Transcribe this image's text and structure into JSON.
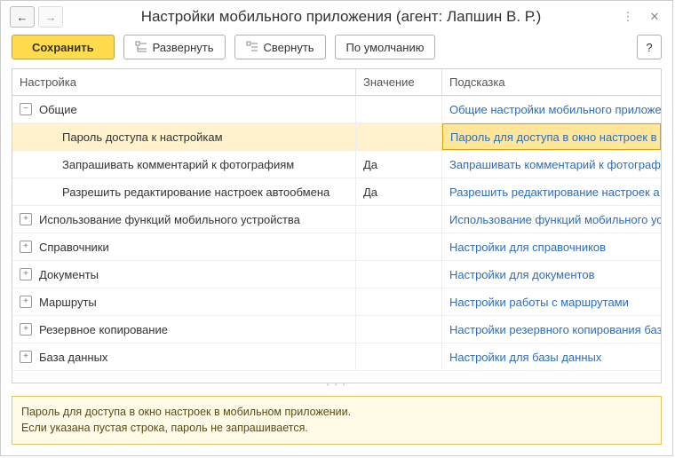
{
  "title": "Настройки мобильного приложения (агент: Лапшин В. Р.)",
  "toolbar": {
    "save_label": "Сохранить",
    "expand_label": "Развернуть",
    "collapse_label": "Свернуть",
    "default_label": "По умолчанию",
    "help_label": "?"
  },
  "columns": {
    "name": "Настройка",
    "value": "Значение",
    "hint": "Подсказка"
  },
  "rows": [
    {
      "expander": "−",
      "indent": 0,
      "name": "Общие",
      "value": "",
      "hint": "Общие настройки мобильного приложе…",
      "selected": false
    },
    {
      "expander": "",
      "indent": 1,
      "name": "Пароль доступа к настройкам",
      "value": "",
      "hint": "Пароль для доступа в окно настроек в …",
      "selected": true
    },
    {
      "expander": "",
      "indent": 1,
      "name": "Запрашивать комментарий к фотографиям",
      "value": "Да",
      "hint": "Запрашивать комментарий к фотографи…",
      "selected": false
    },
    {
      "expander": "",
      "indent": 1,
      "name": "Разрешить редактирование настроек автообмена",
      "value": "Да",
      "hint": "Разрешить редактирование настроек а…",
      "selected": false
    },
    {
      "expander": "+",
      "indent": 0,
      "name": "Использование функций мобильного устройства",
      "value": "",
      "hint": "Использование функций мобильного ус…",
      "selected": false
    },
    {
      "expander": "+",
      "indent": 0,
      "name": "Справочники",
      "value": "",
      "hint": "Настройки для справочников",
      "selected": false
    },
    {
      "expander": "+",
      "indent": 0,
      "name": "Документы",
      "value": "",
      "hint": "Настройки для документов",
      "selected": false
    },
    {
      "expander": "+",
      "indent": 0,
      "name": "Маршруты",
      "value": "",
      "hint": "Настройки работы с маршрутами",
      "selected": false
    },
    {
      "expander": "+",
      "indent": 0,
      "name": "Резервное копирование",
      "value": "",
      "hint": "Настройки резервного копирования баз…",
      "selected": false
    },
    {
      "expander": "+",
      "indent": 0,
      "name": "База данных",
      "value": "",
      "hint": "Настройки для базы данных",
      "selected": false
    }
  ],
  "hintbox": {
    "line1": "Пароль для доступа в окно настроек в мобильном приложении.",
    "line2": "Если указана пустая строка, пароль не запрашивается."
  }
}
